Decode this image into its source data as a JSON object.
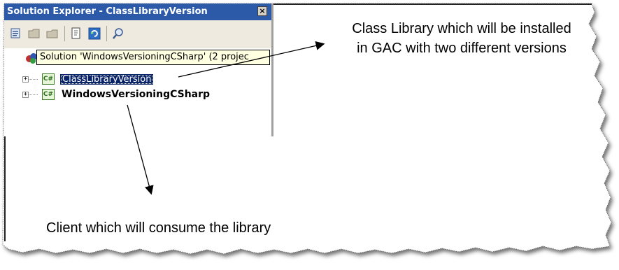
{
  "panel": {
    "title": "Solution Explorer - ClassLibraryVersion",
    "close_glyph": "×"
  },
  "toolbar": {
    "icons": [
      "properties-icon",
      "show-all-files-icon",
      "folder-icon",
      "view-code-icon",
      "refresh-icon",
      "class-view-icon"
    ]
  },
  "tree": {
    "solution_tooltip": "Solution 'WindowsVersioningCSharp' (2 projec",
    "projects": [
      {
        "label": "ClassLibraryVersion",
        "icon_text": "C#",
        "expander": "+",
        "selected": true
      },
      {
        "label": "WindowsVersioningCSharp",
        "icon_text": "C#",
        "expander": "+",
        "selected": false
      }
    ]
  },
  "annotations": {
    "top_right": [
      "Class Library which will be installed",
      "in GAC with two different versions"
    ],
    "bottom": "Client which will consume the library"
  }
}
